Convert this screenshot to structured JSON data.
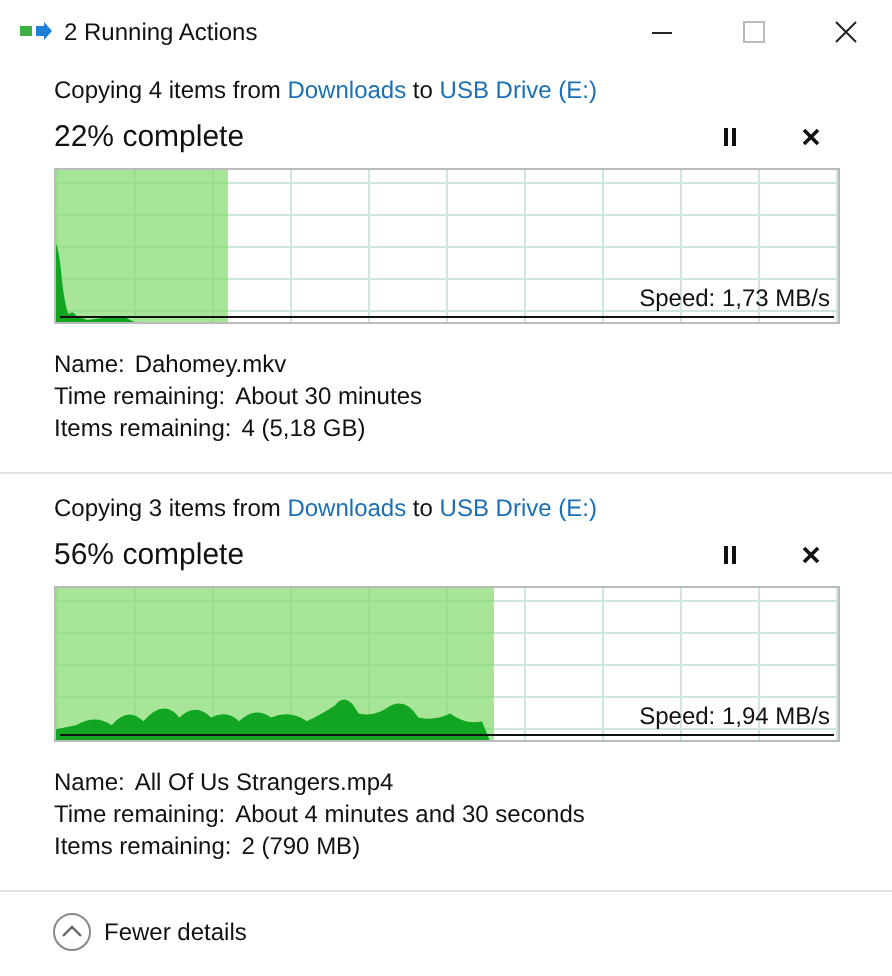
{
  "window": {
    "title": "2 Running Actions"
  },
  "operations": [
    {
      "prefix": "Copying 4 items from",
      "source": "Downloads",
      "joiner": "to",
      "destination": "USB Drive (E:)",
      "progress_text": "22% complete",
      "level": 0.22,
      "speed": "Speed: 1,73 MB/s",
      "details": [
        {
          "label": "Name:",
          "value": "Dahomey.mkv"
        },
        {
          "label": "Time remaining:",
          "value": "About 30 minutes"
        },
        {
          "label": "Items remaining:",
          "value": "4 (5,18 GB)"
        }
      ]
    },
    {
      "prefix": "Copying 3 items from",
      "source": "Downloads",
      "joiner": "to",
      "destination": "USB Drive (E:)",
      "progress_text": "56% complete",
      "level": 0.56,
      "speed": "Speed: 1,94 MB/s",
      "details": [
        {
          "label": "Name:",
          "value": "All Of Us Strangers.mp4"
        },
        {
          "label": "Time remaining:",
          "value": "About 4 minutes and 30 seconds"
        },
        {
          "label": "Items remaining:",
          "value": "2 (790 MB)"
        }
      ]
    }
  ],
  "footer": {
    "toggle": "Fewer details",
    "expanded": true
  }
}
